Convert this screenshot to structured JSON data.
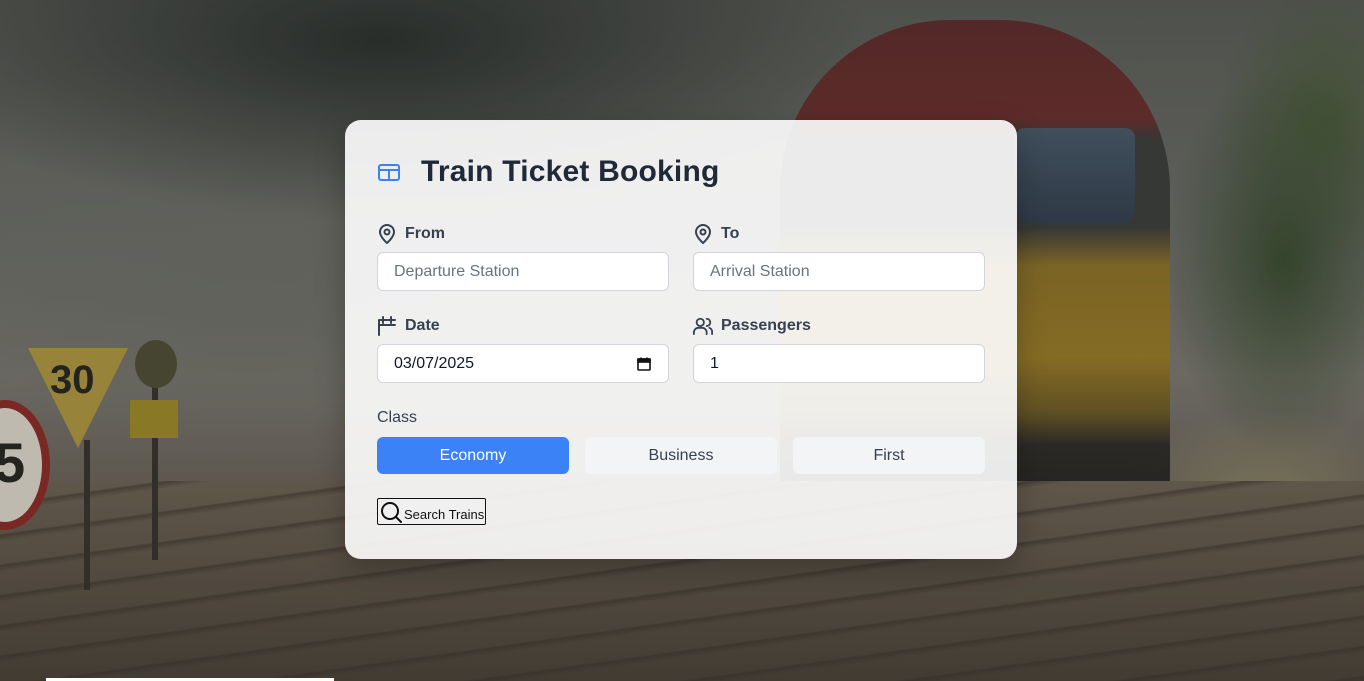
{
  "colors": {
    "accent": "#3b82f6",
    "title": "#1f2937",
    "label": "#374151",
    "placeholder": "#6b7280"
  },
  "background": {
    "sign_speed": "30",
    "sign_round": "5"
  },
  "form": {
    "title": "Train Ticket Booking",
    "title_icon": "ticket-icon",
    "from": {
      "label": "From",
      "icon": "map-pin-icon",
      "value": "",
      "placeholder": "Departure Station"
    },
    "to": {
      "label": "To",
      "icon": "map-pin-icon",
      "value": "",
      "placeholder": "Arrival Station"
    },
    "date": {
      "label": "Date",
      "icon": "calendar-icon",
      "value": "03/07/2025"
    },
    "passengers": {
      "label": "Passengers",
      "icon": "users-icon",
      "value": "1"
    },
    "class_label": "Class",
    "classes": [
      {
        "label": "Economy",
        "selected": true
      },
      {
        "label": "Business",
        "selected": false
      },
      {
        "label": "First",
        "selected": false
      }
    ],
    "search_label": "Search Trains",
    "search_icon": "search-icon"
  }
}
